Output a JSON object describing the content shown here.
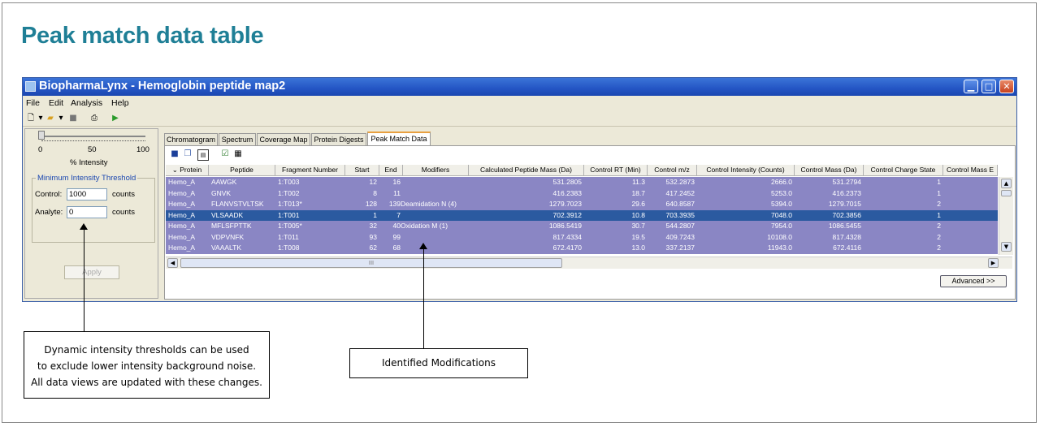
{
  "page_title": "Peak match data table",
  "window": {
    "title": "BiopharmaLynx - Hemoglobin peptide map2",
    "menu": [
      "File",
      "Edit",
      "Analysis",
      "Help"
    ]
  },
  "left_panel": {
    "slider_ticks": [
      "0",
      "50",
      "100"
    ],
    "slider_label": "% Intensity",
    "slider_value_percent": 0,
    "group_title": "Minimum Intensity Threshold",
    "control_label": "Control:",
    "control_value": "1000",
    "control_unit": "counts",
    "analyte_label": "Analyte:",
    "analyte_value": "0",
    "analyte_unit": "counts",
    "apply_label": "Apply"
  },
  "tabs": [
    {
      "label": "Chromatogram",
      "active": false
    },
    {
      "label": "Spectrum",
      "active": false
    },
    {
      "label": "Coverage Map",
      "active": false
    },
    {
      "label": "Protein Digests",
      "active": false
    },
    {
      "label": "Peak Match Data",
      "active": true
    }
  ],
  "table": {
    "columns": [
      "Protein",
      "Peptide",
      "Fragment Number",
      "Start",
      "End",
      "Modifiers",
      "Calculated Peptide Mass (Da)",
      "Control RT (Min)",
      "Control m/z",
      "Control Intensity (Counts)",
      "Control Mass (Da)",
      "Control Charge State",
      "Control Mass E"
    ],
    "rows": [
      [
        "Hemo_A",
        "AAWGK",
        "1:T003",
        "12",
        "16",
        "",
        "531.2805",
        "11.3",
        "532.2873",
        "2666.0",
        "531.2794",
        "1",
        ""
      ],
      [
        "Hemo_A",
        "GNVK",
        "1:T002",
        "8",
        "11",
        "",
        "416.2383",
        "18.7",
        "417.2452",
        "5253.0",
        "416.2373",
        "1",
        ""
      ],
      [
        "Hemo_A",
        "FLANVSTVLTSK",
        "1:T013*",
        "128",
        "139",
        "Deamidation N (4)",
        "1279.7023",
        "29.6",
        "640.8587",
        "5394.0",
        "1279.7015",
        "2",
        ""
      ],
      [
        "Hemo_A",
        "VLSAADK",
        "1:T001",
        "1",
        "7",
        "",
        "702.3912",
        "10.8",
        "703.3935",
        "7048.0",
        "702.3856",
        "1",
        ""
      ],
      [
        "Hemo_A",
        "MFLSFPTTK",
        "1:T005*",
        "32",
        "40",
        "Oxidation M (1)",
        "1086.5419",
        "30.7",
        "544.2807",
        "7954.0",
        "1086.5455",
        "2",
        ""
      ],
      [
        "Hemo_A",
        "VDPVNFK",
        "1:T011",
        "93",
        "99",
        "",
        "817.4334",
        "19.5",
        "409.7243",
        "10108.0",
        "817.4328",
        "2",
        ""
      ],
      [
        "Hemo_A",
        "VAAALTK",
        "1:T008",
        "62",
        "68",
        "",
        "672.4170",
        "13.0",
        "337.2137",
        "11943.0",
        "672.4116",
        "2",
        ""
      ]
    ],
    "selected_row": 3
  },
  "advanced_label": "Advanced >>",
  "callouts": {
    "threshold": [
      "Dynamic intensity thresholds can be used",
      "to exclude lower intensity background noise.",
      "All data views are updated with these changes."
    ],
    "modifications": "Identified Modifications"
  }
}
